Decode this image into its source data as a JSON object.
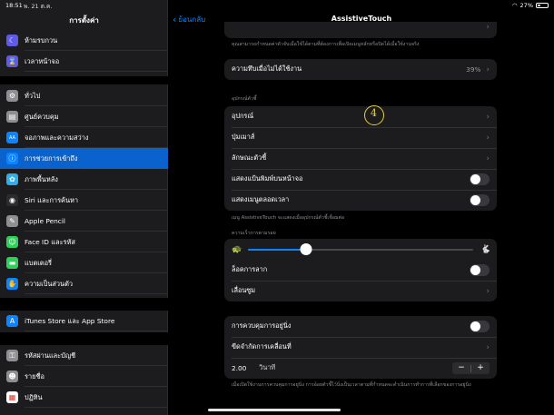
{
  "status": {
    "time": "18:51",
    "date": "พ. 21 ต.ค.",
    "battery": "27%",
    "battery_level": 0.27
  },
  "sidebar": {
    "title": "การตั้งค่า",
    "items": [
      {
        "label": "ห้ามรบกวน",
        "icon": "moon-icon",
        "color": "#5e5ce6"
      },
      {
        "label": "เวลาหน้าจอ",
        "icon": "hourglass-icon",
        "color": "#5e5ce6"
      },
      {
        "label": "ทั่วไป",
        "icon": "gear-icon",
        "color": "#8e8e93"
      },
      {
        "label": "ศูนย์ควบคุม",
        "icon": "switches-icon",
        "color": "#8e8e93"
      },
      {
        "label": "จอภาพและความสว่าง",
        "icon": "aa-icon",
        "color": "#0a84ff"
      },
      {
        "label": "การช่วยการเข้าถึง",
        "icon": "accessibility-icon",
        "color": "#0a84ff",
        "selected": true
      },
      {
        "label": "ภาพพื้นหลัง",
        "icon": "flower-icon",
        "color": "#32ade6"
      },
      {
        "label": "Siri และการค้นหา",
        "icon": "siri-icon",
        "color": "#2c2c2e"
      },
      {
        "label": "Apple Pencil",
        "icon": "pencil-icon",
        "color": "#8e8e93"
      },
      {
        "label": "Face ID และรหัส",
        "icon": "face-id-icon",
        "color": "#30d158"
      },
      {
        "label": "แบตเตอรี่",
        "icon": "battery-icon",
        "color": "#30d158"
      },
      {
        "label": "ความเป็นส่วนตัว",
        "icon": "hand-icon",
        "color": "#0a84ff"
      },
      {
        "label": "iTunes Store และ App Store",
        "icon": "app-store-icon",
        "color": "#0a84ff"
      },
      {
        "label": "รหัสผ่านและบัญชี",
        "icon": "key-icon",
        "color": "#8e8e93"
      },
      {
        "label": "รายชื่อ",
        "icon": "contacts-icon",
        "color": "#8e8e93"
      },
      {
        "label": "ปฏิทิน",
        "icon": "calendar-icon",
        "color": "#ffffff"
      }
    ]
  },
  "nav": {
    "back_label": "ย้อนกลับ",
    "title": "AssistiveTouch"
  },
  "top_caption": "คุณสามารถกำหนดค่าตัวจับเมื่อใช้ได้ตามที่ต้องการเพื่อเปิดเมนูหลักหรือปิดได้เมื่อใช้งานจริง",
  "idle": {
    "label": "ความทึบเมื่อไม่ได้ใช้งาน",
    "value": "39%"
  },
  "devices": {
    "header": "อุปกรณ์ตัวชี้",
    "rows": [
      {
        "label": "อุปกรณ์"
      },
      {
        "label": "ปุ่มเมาส์"
      },
      {
        "label": "ลักษณะตัวชี้"
      }
    ],
    "toggles": [
      {
        "label": "แสดงแป้นพิมพ์บนหน้าจอ"
      },
      {
        "label": "แสดงเมนูตลอดเวลา"
      }
    ],
    "caption": "เมนู AssistiveTouch จะแสดงเมื่ออุปกรณ์ตัวชี้เชื่อมต่อ"
  },
  "tracking": {
    "header": "ความเร็วการตามรอย",
    "speed_fraction": 0.26,
    "drag_lock_label": "ล็อคการลาก",
    "zoom_label": "เลื่อนซูม"
  },
  "dwell": {
    "label": "การควบคุมการอยู่นิ่ง",
    "tolerance_label": "ขีดจำกัดการเคลื่อนที่",
    "value": "2.00",
    "unit": "วินาที",
    "minus": "−",
    "plus": "+",
    "caption": "เมื่อเปิดใช้งานการควบคุมการอยู่นิ่ง การอ้อยตัวชี้ไว้นิ่งเป็นเวลาตามที่กำหนดจะดำเนินการทำการที่เลือกของการอยู่นิ่ง"
  },
  "annotation": {
    "text": "4"
  }
}
